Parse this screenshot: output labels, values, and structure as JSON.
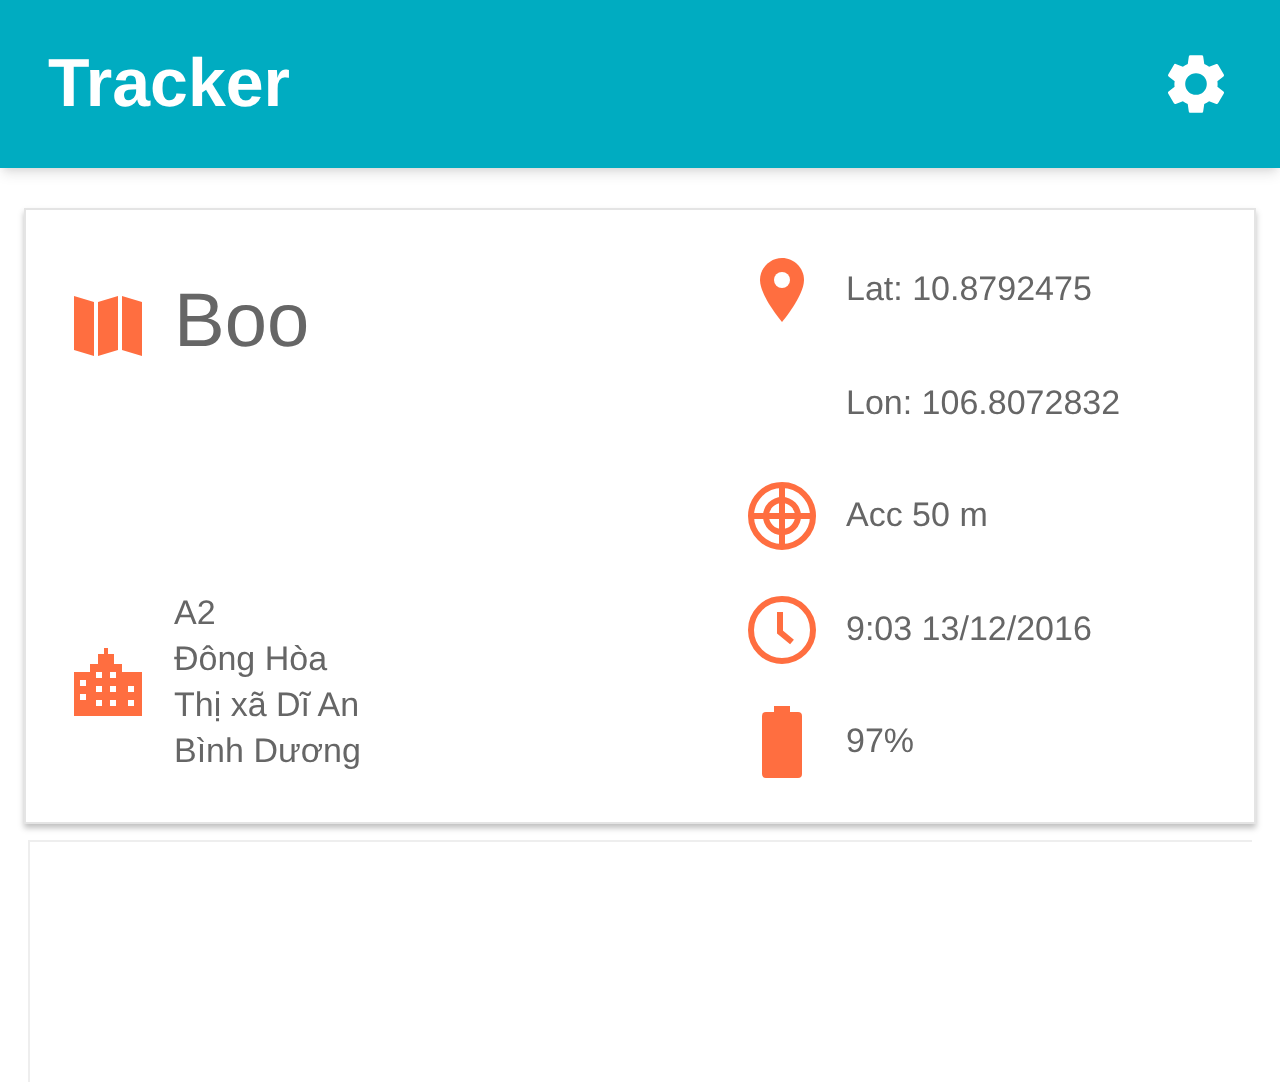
{
  "app_bar": {
    "title": "Tracker"
  },
  "device": {
    "name": "Boo",
    "address": [
      "A2",
      "Đông Hòa",
      "Thị xã Dĩ An",
      "Bình Dương"
    ],
    "details": [
      {
        "kind": "location",
        "text": "Lat: 10.8792475"
      },
      {
        "kind": "plain",
        "text": "Lon: 106.8072832"
      },
      {
        "kind": "accuracy",
        "text": "Acc 50 m"
      },
      {
        "kind": "time",
        "text": "9:03 13/12/2016"
      },
      {
        "kind": "battery",
        "text": "97%"
      }
    ]
  }
}
